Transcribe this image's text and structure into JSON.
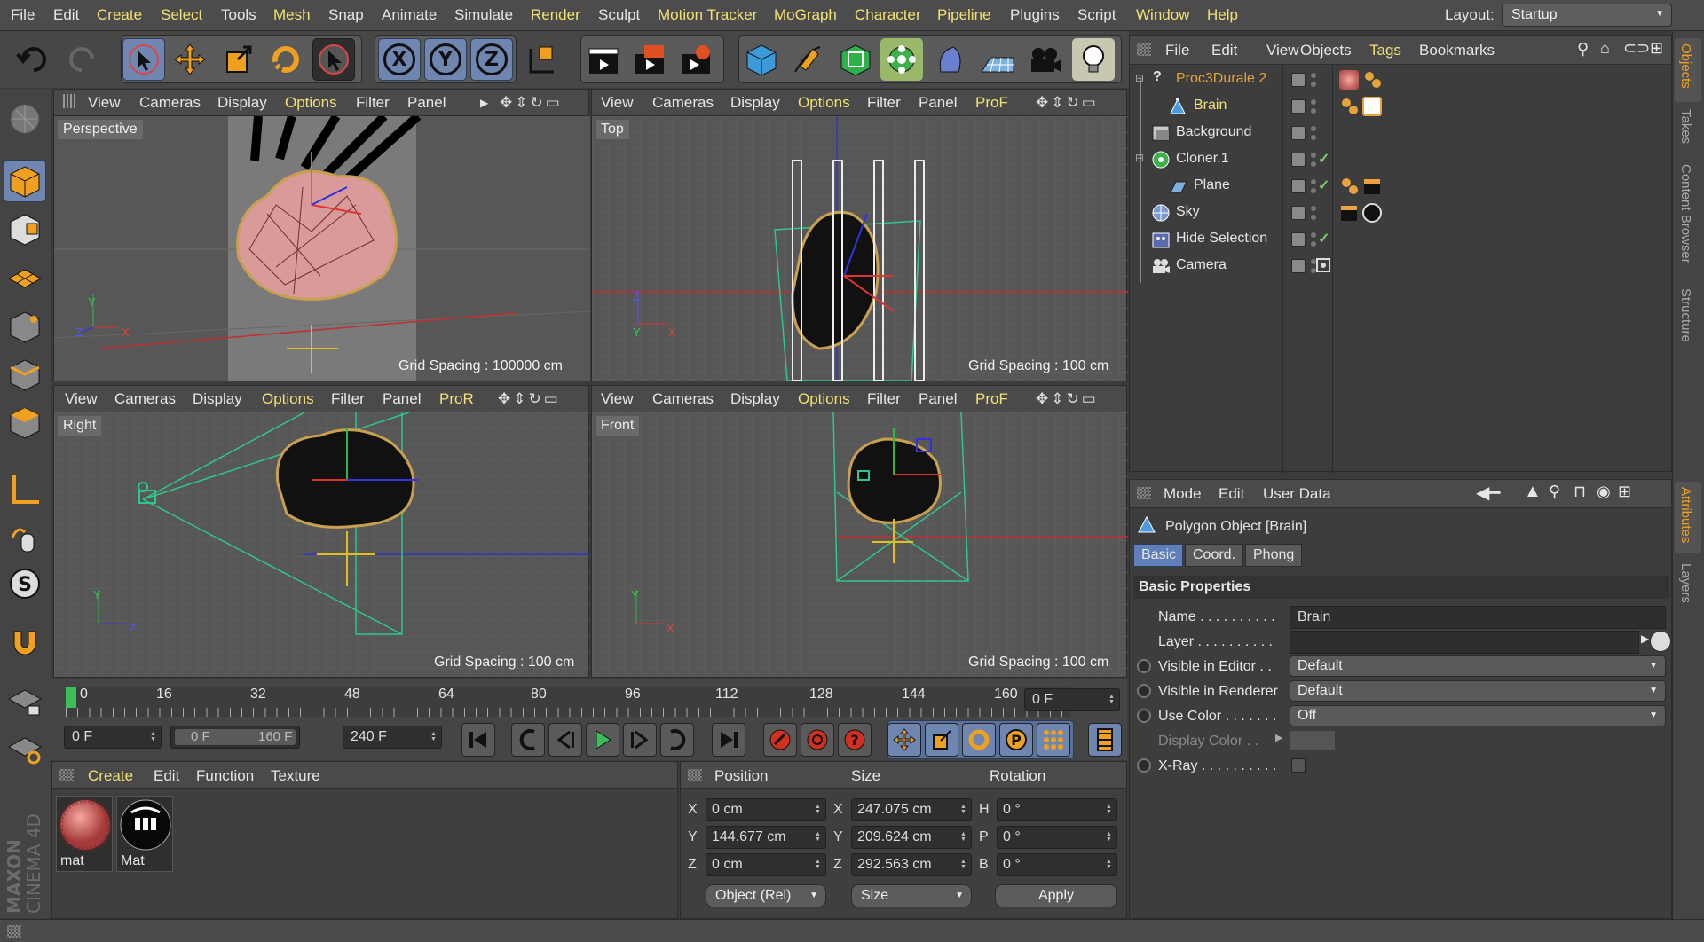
{
  "menu": {
    "items": [
      "File",
      "Edit",
      "Create",
      "Select",
      "Tools",
      "Mesh",
      "Snap",
      "Animate",
      "Simulate",
      "Render",
      "Sculpt",
      "Motion Tracker",
      "MoGraph",
      "Character",
      "Pipeline",
      "Plugins",
      "Script",
      "Window",
      "Help"
    ],
    "highlighted": [
      "Create",
      "Select",
      "Mesh",
      "Render",
      "Motion Tracker",
      "MoGraph",
      "Character",
      "Pipeline",
      "Window",
      "Help"
    ],
    "layout_label": "Layout:",
    "layout_value": "Startup"
  },
  "toolbar": {
    "axis_x": "X",
    "axis_y": "Y",
    "axis_z": "Z"
  },
  "viewports": {
    "perspective": {
      "menu": [
        "View",
        "Cameras",
        "Display",
        "Options",
        "Filter",
        "Panel"
      ],
      "name": "Perspective",
      "grid": "Grid Spacing : 100000 cm"
    },
    "top": {
      "menu": [
        "View",
        "Cameras",
        "Display",
        "Options",
        "Filter",
        "Panel",
        "ProF"
      ],
      "name": "Top",
      "grid": "Grid Spacing : 100 cm"
    },
    "right": {
      "menu": [
        "View",
        "Cameras",
        "Display",
        "Options",
        "Filter",
        "Panel",
        "ProR"
      ],
      "name": "Right",
      "grid": "Grid Spacing : 100 cm"
    },
    "front": {
      "menu": [
        "View",
        "Cameras",
        "Display",
        "Options",
        "Filter",
        "Panel",
        "ProF"
      ],
      "name": "Front",
      "grid": "Grid Spacing : 100 cm"
    },
    "axis": {
      "x": "X",
      "y": "Y",
      "z": "Z"
    }
  },
  "timeline": {
    "ticks": [
      "0",
      "16",
      "32",
      "48",
      "64",
      "80",
      "96",
      "112",
      "128",
      "144",
      "160"
    ],
    "current_frame": "0 F",
    "start": "0 F",
    "range_start": "0 F",
    "range_end": "160 F",
    "end": "240 F"
  },
  "materials": {
    "menu": [
      "Create",
      "Edit",
      "Function",
      "Texture"
    ],
    "items": [
      {
        "name": "mat"
      },
      {
        "name": "Mat"
      }
    ]
  },
  "coords": {
    "headers": {
      "position": "Position",
      "size": "Size",
      "rotation": "Rotation"
    },
    "rows": [
      {
        "pl": "X",
        "pv": "0 cm",
        "sl": "X",
        "sv": "247.075 cm",
        "rl": "H",
        "rv": "0 °"
      },
      {
        "pl": "Y",
        "pv": "144.677 cm",
        "sl": "Y",
        "sv": "209.624 cm",
        "rl": "P",
        "rv": "0 °"
      },
      {
        "pl": "Z",
        "pv": "0 cm",
        "sl": "Z",
        "sv": "292.563 cm",
        "rl": "B",
        "rv": "0 °"
      }
    ],
    "mode": "Object (Rel)",
    "size_mode": "Size",
    "apply": "Apply"
  },
  "objects": {
    "menu": [
      "File",
      "Edit",
      "View",
      "Objects",
      "Tags",
      "Bookmarks"
    ],
    "tree": [
      {
        "name": "Proc3Durale 2",
        "indent": 0,
        "color": "#e8a33c",
        "icon": "question-icon"
      },
      {
        "name": "Brain",
        "indent": 1,
        "color": "#f4e074",
        "icon": "polygon-icon"
      },
      {
        "name": "Background",
        "indent": 0,
        "color": "#e6e6e6",
        "icon": "background-icon"
      },
      {
        "name": "Cloner.1",
        "indent": 0,
        "color": "#e6e6e6",
        "icon": "cloner-icon"
      },
      {
        "name": "Plane",
        "indent": 1,
        "color": "#e6e6e6",
        "icon": "plane-icon"
      },
      {
        "name": "Sky",
        "indent": 0,
        "color": "#e6e6e6",
        "icon": "sky-icon"
      },
      {
        "name": "Hide Selection",
        "indent": 0,
        "color": "#e6e6e6",
        "icon": "selection-icon"
      },
      {
        "name": "Camera",
        "indent": 0,
        "color": "#e6e6e6",
        "icon": "camera-icon"
      }
    ]
  },
  "attributes": {
    "menu": [
      "Mode",
      "Edit",
      "User Data"
    ],
    "title": "Polygon Object [Brain]",
    "tabs": [
      "Basic",
      "Coord.",
      "Phong"
    ],
    "section": "Basic Properties",
    "name_label": "Name . . . . . . . . . .",
    "name_value": "Brain",
    "layer_label": "Layer . . . . . . . . . .",
    "visible_editor_label": "Visible in Editor . .",
    "visible_editor_value": "Default",
    "visible_renderer_label": "Visible in Renderer",
    "visible_renderer_value": "Default",
    "use_color_label": "Use Color . . . . . . .",
    "use_color_value": "Off",
    "display_color_label": "Display Color . .",
    "xray_label": "X-Ray . . . . . . . . . ."
  },
  "sidetabs": [
    "Objects",
    "Takes",
    "Content Browser",
    "Structure",
    "Attributes",
    "Layers"
  ],
  "brand": {
    "maxon": "MAXON",
    "product": "CINEMA 4D"
  }
}
